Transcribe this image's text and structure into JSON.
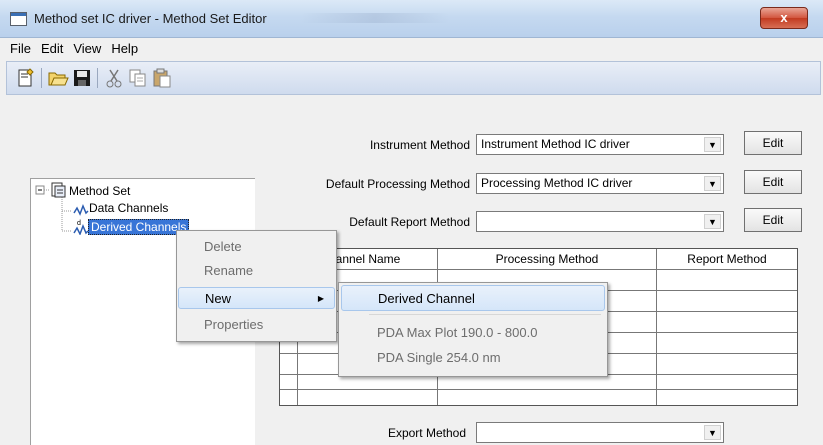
{
  "window": {
    "title": "Method set IC driver - Method Set Editor",
    "close_glyph": "x"
  },
  "menubar": {
    "items": [
      "File",
      "Edit",
      "View",
      "Help"
    ]
  },
  "toolbar": {
    "icons": [
      "new-icon",
      "open-icon",
      "save-icon",
      "cut-icon",
      "copy-icon",
      "paste-icon"
    ]
  },
  "form": {
    "instrument_label": "Instrument Method",
    "instrument_value": "Instrument Method IC driver",
    "processing_label": "Default Processing Method",
    "processing_value": "Processing Method IC driver",
    "report_label": "Default Report Method",
    "report_value": "",
    "export_label": "Export Method",
    "export_value": "",
    "edit_label": "Edit"
  },
  "tree": {
    "root": "Method Set",
    "children": [
      "Data Channels",
      "Derived Channels"
    ],
    "selected": "Derived Channels"
  },
  "grid": {
    "headers": [
      "annel Name",
      "Processing Method",
      "Report Method"
    ]
  },
  "context_menu": {
    "items": [
      {
        "label": "Delete",
        "enabled": false
      },
      {
        "label": "Rename",
        "enabled": false
      },
      {
        "label": "New",
        "enabled": true,
        "submenu": true
      },
      {
        "label": "Properties",
        "enabled": false
      }
    ]
  },
  "submenu": {
    "items": [
      {
        "label": "Derived Channel",
        "enabled": true
      },
      {
        "label": "PDA Max Plot 190.0 - 800.0",
        "enabled": false
      },
      {
        "label": "PDA Single 254.0 nm",
        "enabled": false
      }
    ]
  },
  "colors": {
    "selection": "#3875d7",
    "titlebar": "#c5d9f0",
    "close": "#c23a20"
  }
}
